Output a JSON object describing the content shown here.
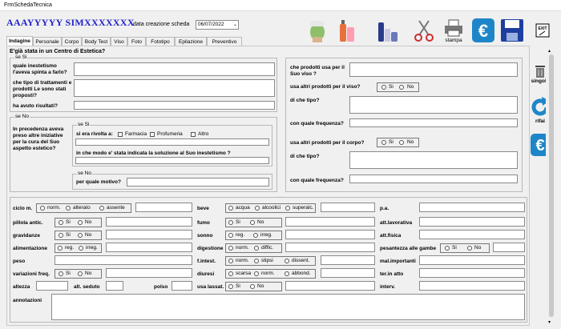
{
  "window": {
    "title": "FrmSchedaTecnica"
  },
  "header": {
    "patient_name": "AAAYYYYY SIMXXXXXXX",
    "date_label": "data creazione scheda",
    "date_value": "06/07/2022",
    "print_label": "stampa"
  },
  "tabs": [
    "Indagine",
    "Personale",
    "Corpo",
    "Body Test",
    "Viso",
    "Foto",
    "Fototipo",
    "Epilazione",
    "Preventivo"
  ],
  "section_title": "E'già stata in un Centro di Estetica?",
  "left_panel": {
    "yes_group": "se Si",
    "q_spinta": "quale inestetismo l'aveva spinta a farlo?",
    "q_trattamenti": "che tipo di trattamenti e prodotti Le sono stati proposti?",
    "q_risultati": "ha avuto risultati?",
    "no_group": "se No",
    "q_iniziative": "In precedenza aveva preso altre iniziative per la cura del Suo aspetto estetico?",
    "sub_yes": "se Si",
    "q_rivolta": "si era rivolta a:",
    "farmacia": "Farmacia",
    "profumeria": "Profumeria",
    "altro": "Altro",
    "q_soluzione": "in che modo e' stata indicata la soluzione al Suo inestetismo ?",
    "sub_no": "se No",
    "q_motivo": "per quale motivo?"
  },
  "right_panel": {
    "q_prodotti_viso": "che prodotti usa per il Suo viso ?",
    "q_altri_viso": "usa altri prodotti per il viso?",
    "q_tipo1": "di che tipo?",
    "q_freq1": "con quale frequenza?",
    "q_altri_corpo": "usa altri prodotti per il corpo?",
    "q_tipo2": "di che tipo?",
    "q_freq2": "con quale frequenza?",
    "si": "Si",
    "no": "No"
  },
  "side_buttons": {
    "singola": "singola",
    "rifai": "rifai"
  },
  "bottom": {
    "ciclo": "ciclo m.",
    "norm": "norm.",
    "alterato": "alterato",
    "assente": "assente",
    "beve": "beve",
    "acqua": "acqua",
    "alcoolici": "alcoolici",
    "superalc": "superalc.",
    "pa": "p.a.",
    "pillola": "pillola antic.",
    "si": "Si",
    "no": "No",
    "fumo": "fumo",
    "att_lav": "att.lavorativa",
    "gravidanze": "gravidanze",
    "sonno": "sonno",
    "reg": "reg.",
    "irreg": "irreg.",
    "att_fis": "att.fisica",
    "alimentazione": "alimentazione",
    "digestione": "digestione",
    "diffic": "diffic.",
    "pesantezza": "pesantezza alle gambe",
    "peso": "peso",
    "f_intest": "f.intest.",
    "stipsi": "stipsi",
    "dissent": "dissent.",
    "mal_imp": "mal.importanti",
    "variazioni": "variazioni freq.",
    "diuresi": "diuresi",
    "scarsa": "scarsa",
    "abbond": "abbond.",
    "ter_atto": "ter.in atto",
    "altezza": "altezza",
    "alt_seduto": "alt. seduto",
    "polso": "polso",
    "lassat": "usa lassat.",
    "interv": "interv.",
    "annotazioni": "annotazioni"
  },
  "icons": [
    "face-mask-icon",
    "cosmetic-bottles-icon",
    "skincare-products-icon",
    "scissors-icon",
    "printer-icon",
    "euro-icon",
    "save-disk-icon",
    "exit-icon",
    "trash-icon",
    "refresh-icon",
    "euro-icon"
  ]
}
